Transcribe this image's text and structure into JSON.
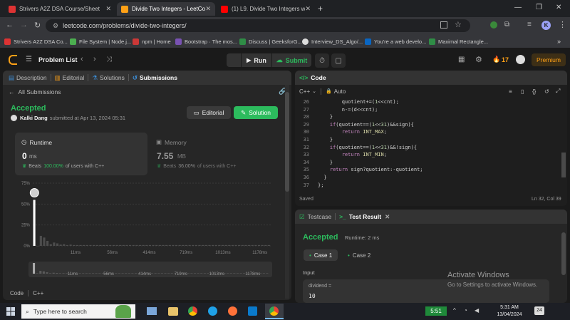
{
  "browser": {
    "tabs": [
      {
        "label": "Strivers A2Z DSA Course/Sheet",
        "active": false
      },
      {
        "label": "Divide Two Integers - LeetCode",
        "active": true
      },
      {
        "label": "(1) L9. Divide Two Integers with",
        "active": false
      }
    ],
    "url": "leetcode.com/problems/divide-two-integers/",
    "bookmarks": [
      "Strivers A2Z DSA Co...",
      "File System | Node.j...",
      "npm | Home",
      "Bootstrap · The mos...",
      "Discuss | GeeksforG...",
      "Interview_DS_Algo/...",
      "You're a web develo...",
      "Maximal Rectangle..."
    ],
    "profile_initial": "K"
  },
  "nav": {
    "problem_list": "Problem List",
    "run": "Run",
    "submit": "Submit",
    "streak": "17",
    "premium": "Premium"
  },
  "left": {
    "tabs": [
      "Description",
      "Editorial",
      "Solutions",
      "Submissions"
    ],
    "all_submissions": "All Submissions",
    "status": "Accepted",
    "user": "Kalki Dang",
    "submitted_at": "submitted at Apr 13, 2024 05:31",
    "editorial_btn": "Editorial",
    "solution_btn": "Solution",
    "runtime": {
      "title": "Runtime",
      "value": "0",
      "unit": "ms",
      "beats_label": "Beats",
      "beats": "100.00%",
      "suffix": "of users with C++"
    },
    "memory": {
      "title": "Memory",
      "value": "7.55",
      "unit": "MB",
      "beats_label": "Beats",
      "beats": "36.00%",
      "suffix": "of users with C++"
    },
    "footer_code": "Code",
    "footer_lang": "C++"
  },
  "chart_data": {
    "type": "bar",
    "yticks": [
      "75%",
      "50%",
      "25%",
      "0%"
    ],
    "ylim": [
      0,
      75
    ],
    "xticks": [
      "11ms",
      "56ms",
      "414ms",
      "719ms",
      "1013ms",
      "1178ms"
    ],
    "values": [
      55,
      0,
      12,
      10,
      6,
      2,
      4,
      3,
      1.5,
      2,
      1,
      1.5,
      1,
      1,
      1,
      1,
      1,
      1,
      1,
      1,
      1,
      1,
      1,
      1,
      1,
      1,
      1,
      1,
      1,
      1,
      1,
      1,
      1,
      1,
      1,
      1,
      1,
      1,
      1,
      1,
      1,
      1,
      1,
      1,
      1,
      1,
      1,
      1,
      1,
      1,
      1,
      1,
      1,
      1,
      1,
      1,
      1,
      1,
      1,
      1,
      1,
      1,
      1,
      1,
      1,
      1,
      1,
      1,
      1,
      1,
      1,
      1
    ],
    "highlight_index": 0,
    "overview_xticks": [
      "11ms",
      "56ms",
      "414ms",
      "719ms",
      "1013ms",
      "1178ms"
    ]
  },
  "editor": {
    "title": "Code",
    "lang": "C++",
    "autosave": "Auto",
    "lines": [
      {
        "n": "26",
        "t": "        quotient+=(1<<cnt);"
      },
      {
        "n": "27",
        "t": "        n-=(d<<cnt);"
      },
      {
        "n": "28",
        "t": "    }"
      },
      {
        "n": "29",
        "t": "    if(quotient==(1<<31)&&sign){"
      },
      {
        "n": "30",
        "t": "        return INT_MAX;"
      },
      {
        "n": "31",
        "t": "    }"
      },
      {
        "n": "32",
        "t": "    if(quotient==(1<<31)&&!sign){"
      },
      {
        "n": "33",
        "t": "        return INT_MIN;"
      },
      {
        "n": "34",
        "t": "    }"
      },
      {
        "n": "35",
        "t": "    return sign?quotient:-quotient;"
      },
      {
        "n": "36",
        "t": "  }"
      },
      {
        "n": "37",
        "t": "};"
      }
    ],
    "saved": "Saved",
    "cursor": "Ln 32, Col 39"
  },
  "result": {
    "tabs": [
      "Testcase",
      "Test Result"
    ],
    "status": "Accepted",
    "runtime": "Runtime: 2 ms",
    "cases": [
      "Case 1",
      "Case 2"
    ],
    "input_label": "Input",
    "var": "dividend =",
    "val": "10"
  },
  "watermark": {
    "title": "Activate Windows",
    "sub": "Go to Settings to activate Windows."
  },
  "taskbar": {
    "search": "Type here to search",
    "time": "5:31 AM",
    "date": "13/04/2024",
    "timer": "5:51"
  },
  "colors": {
    "accent_green": "#2cbb5d",
    "premium": "#ffa116",
    "bg": "#1a1a1a",
    "panel": "#262626"
  }
}
